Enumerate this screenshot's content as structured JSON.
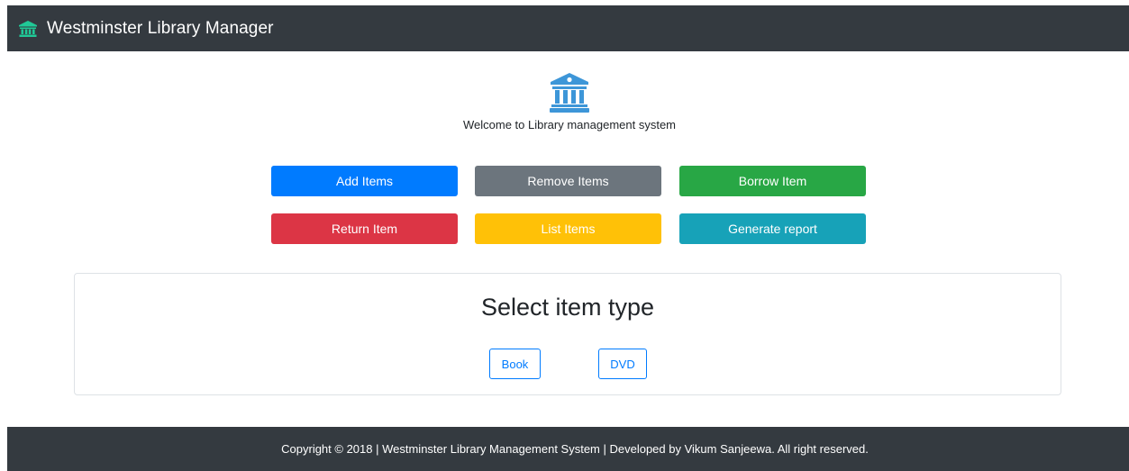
{
  "navbar": {
    "brand_title": "Westminster Library Manager",
    "icon": "bank-icon"
  },
  "hero": {
    "icon": "bank-icon",
    "welcome_text": "Welcome to Library management system"
  },
  "actions": {
    "add_items": "Add Items",
    "remove_items": "Remove Items",
    "borrow_item": "Borrow Item",
    "return_item": "Return Item",
    "list_items": "List Items",
    "generate_report": "Generate report"
  },
  "item_type_card": {
    "title": "Select item type",
    "book_label": "Book",
    "dvd_label": "DVD"
  },
  "footer": {
    "text": "Copyright © 2018 | Westminster Library Management System | Developed by Vikum Sanjeewa. All right reserved."
  },
  "colors": {
    "navbar_bg": "#343a40",
    "brand_icon": "#20c997",
    "hero_icon": "#3d96d8",
    "primary": "#007bff",
    "secondary": "#6c757d",
    "success": "#28a745",
    "danger": "#dc3545",
    "warning": "#ffc107",
    "info": "#17a2b8"
  }
}
